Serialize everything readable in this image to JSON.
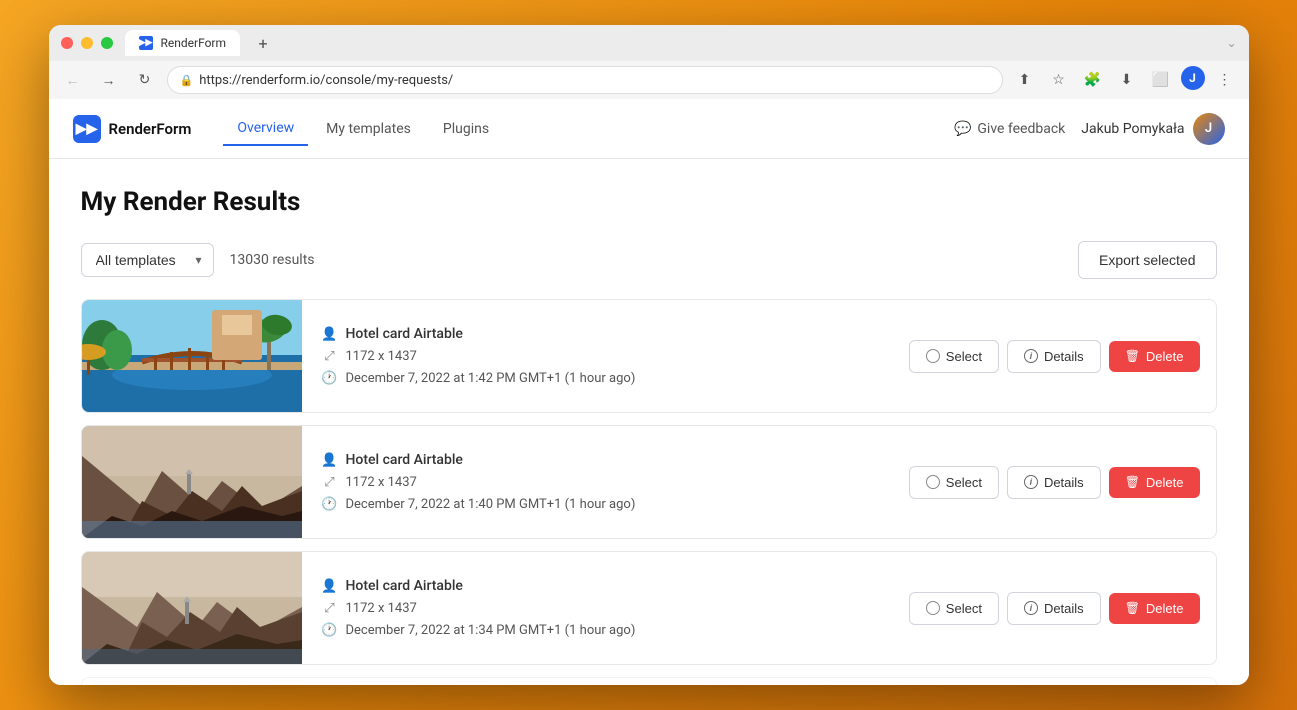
{
  "browser": {
    "url": "https://renderform.io/console/my-requests/",
    "tab_title": "RenderForm",
    "chevron": "›"
  },
  "nav": {
    "brand_name": "RenderForm",
    "links": [
      {
        "id": "overview",
        "label": "Overview",
        "active": true
      },
      {
        "id": "my-templates",
        "label": "My templates",
        "active": false
      },
      {
        "id": "plugins",
        "label": "Plugins",
        "active": false
      }
    ],
    "feedback_label": "Give feedback",
    "user_name": "Jakub Pomykała",
    "user_initials": "J"
  },
  "page": {
    "title": "My Render Results",
    "filter_placeholder": "All templates",
    "results_count": "13030 results",
    "export_btn": "Export selected"
  },
  "results": [
    {
      "id": "r1",
      "template_name": "Hotel card Airtable",
      "dimensions": "1172 x 1437",
      "timestamp": "December 7, 2022 at 1:42 PM GMT+1 (1 hour ago)",
      "thumb_type": "pool"
    },
    {
      "id": "r2",
      "template_name": "Hotel card Airtable",
      "dimensions": "1172 x 1437",
      "timestamp": "December 7, 2022 at 1:40 PM GMT+1 (1 hour ago)",
      "thumb_type": "mountain"
    },
    {
      "id": "r3",
      "template_name": "Hotel card Airtable",
      "dimensions": "1172 x 1437",
      "timestamp": "December 7, 2022 at 1:34 PM GMT+1 (1 hour ago)",
      "thumb_type": "mountain"
    }
  ],
  "buttons": {
    "select": "Select",
    "details": "Details",
    "delete": "Delete"
  },
  "colors": {
    "primary": "#2563eb",
    "delete": "#ef4444",
    "border": "#e5e7eb"
  }
}
